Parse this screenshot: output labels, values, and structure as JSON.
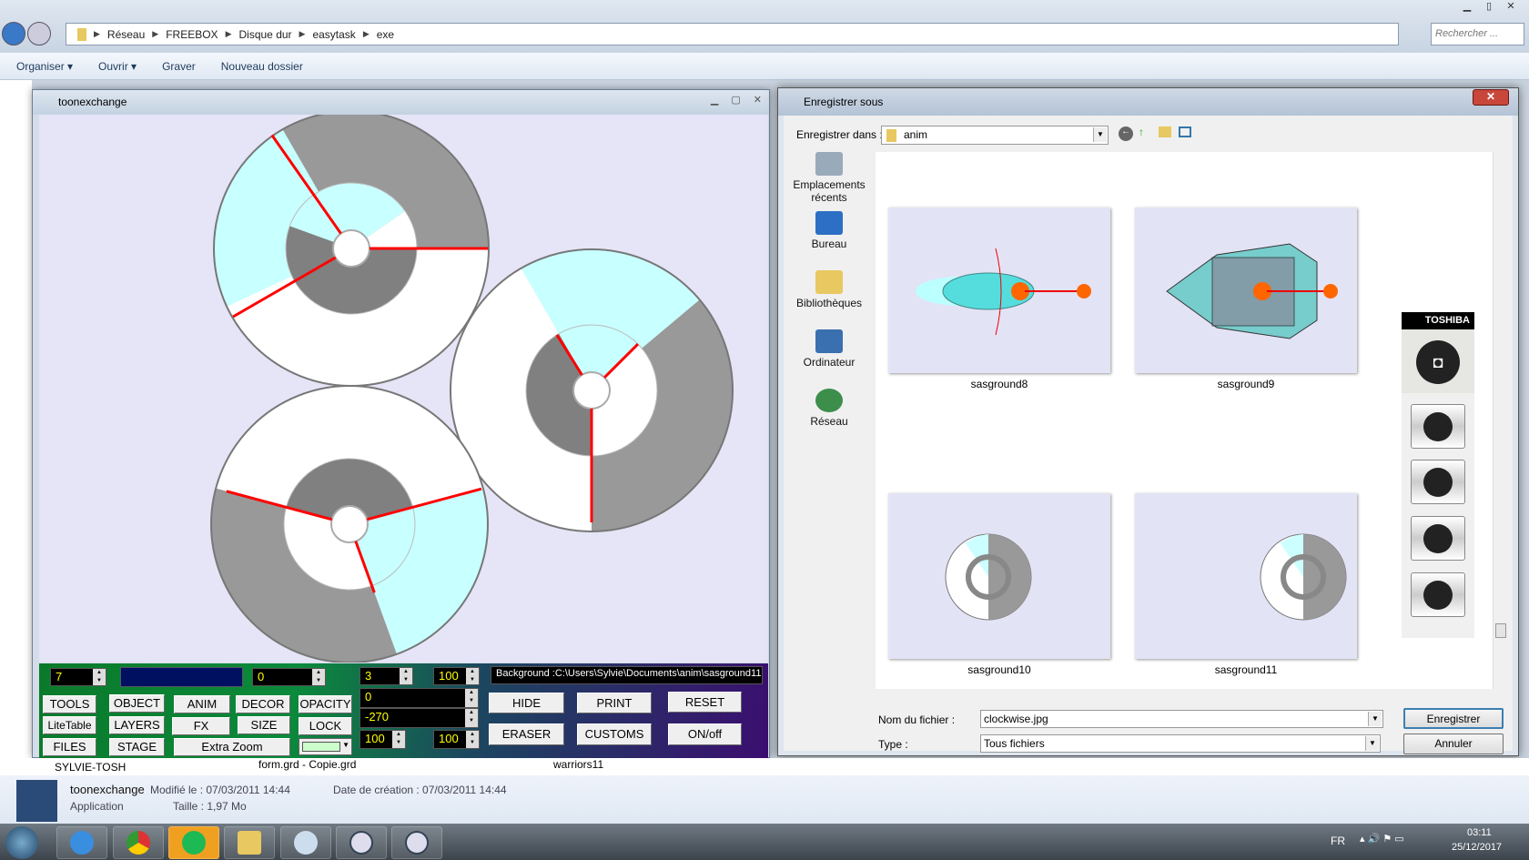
{
  "explorer": {
    "breadcrumb": [
      "Réseau",
      "FREEBOX",
      "Disque dur",
      "easytask",
      "exe"
    ],
    "search_placeholder": "Rechercher ...",
    "commands": {
      "organize": "Organiser ▾",
      "open": "Ouvrir ▾",
      "burn": "Graver",
      "new_folder": "Nouveau dossier"
    },
    "strip": {
      "computer": "SYLVIE-TOSH",
      "file1": "form.grd - Copie.grd",
      "file2": "warriors11"
    },
    "details": {
      "name": "toonexchange",
      "modified": "Modifié le : 07/03/2011 14:44",
      "created": "Date de création : 07/03/2011 14:44",
      "type": "Application",
      "size": "Taille : 1,97 Mo"
    }
  },
  "app": {
    "title": "toonexchange",
    "fields": {
      "layer": "7",
      "angle": "0",
      "frames": "3",
      "zoom": "100",
      "rot_x": "0",
      "rot_y": "-270",
      "scale_a": "100",
      "scale_b": "100"
    },
    "background_path": "Background   :C:\\Users\\Sylvie\\Documents\\anim\\sasground11",
    "buttons": {
      "tools": "TOOLS",
      "object": "OBJECT",
      "anim": "ANIM",
      "decor": "DECOR",
      "opacity": "OPACITY",
      "litetable": "LiteTable",
      "layers": "LAYERS",
      "fx": "FX",
      "size": "SIZE",
      "lock": "LOCK",
      "files": "FILES",
      "stage": "STAGE",
      "extra_zoom": "Extra Zoom",
      "hide": "HIDE",
      "print": "PRINT",
      "reset": "RESET",
      "eraser": "ERASER",
      "customs": "CUSTOMS",
      "onoff": "ON/off"
    },
    "colors": {
      "cyan": "#c8ffff",
      "gray": "#999999",
      "dark": "#808080",
      "red": "#ff0000",
      "canvas": "#e5e5f7",
      "color_swatch": "#ccffcc"
    }
  },
  "dialog": {
    "title": "Enregistrer sous",
    "save_in_label": "Enregistrer dans :",
    "save_in_value": "anim",
    "places": [
      "Emplacements récents",
      "Bureau",
      "Bibliothèques",
      "Ordinateur",
      "Réseau"
    ],
    "files": [
      "sasground8",
      "sasground9",
      "sasground10",
      "sasground11"
    ],
    "filename_label": "Nom du fichier :",
    "filename_value": "clockwise.jpg",
    "type_label": "Type :",
    "type_value": "Tous fichiers",
    "save_button": "Enregistrer",
    "cancel_button": "Annuler",
    "toshiba_brand": "TOSHIBA"
  },
  "taskbar": {
    "lang": "FR",
    "time": "03:11",
    "date": "25/12/2017"
  }
}
